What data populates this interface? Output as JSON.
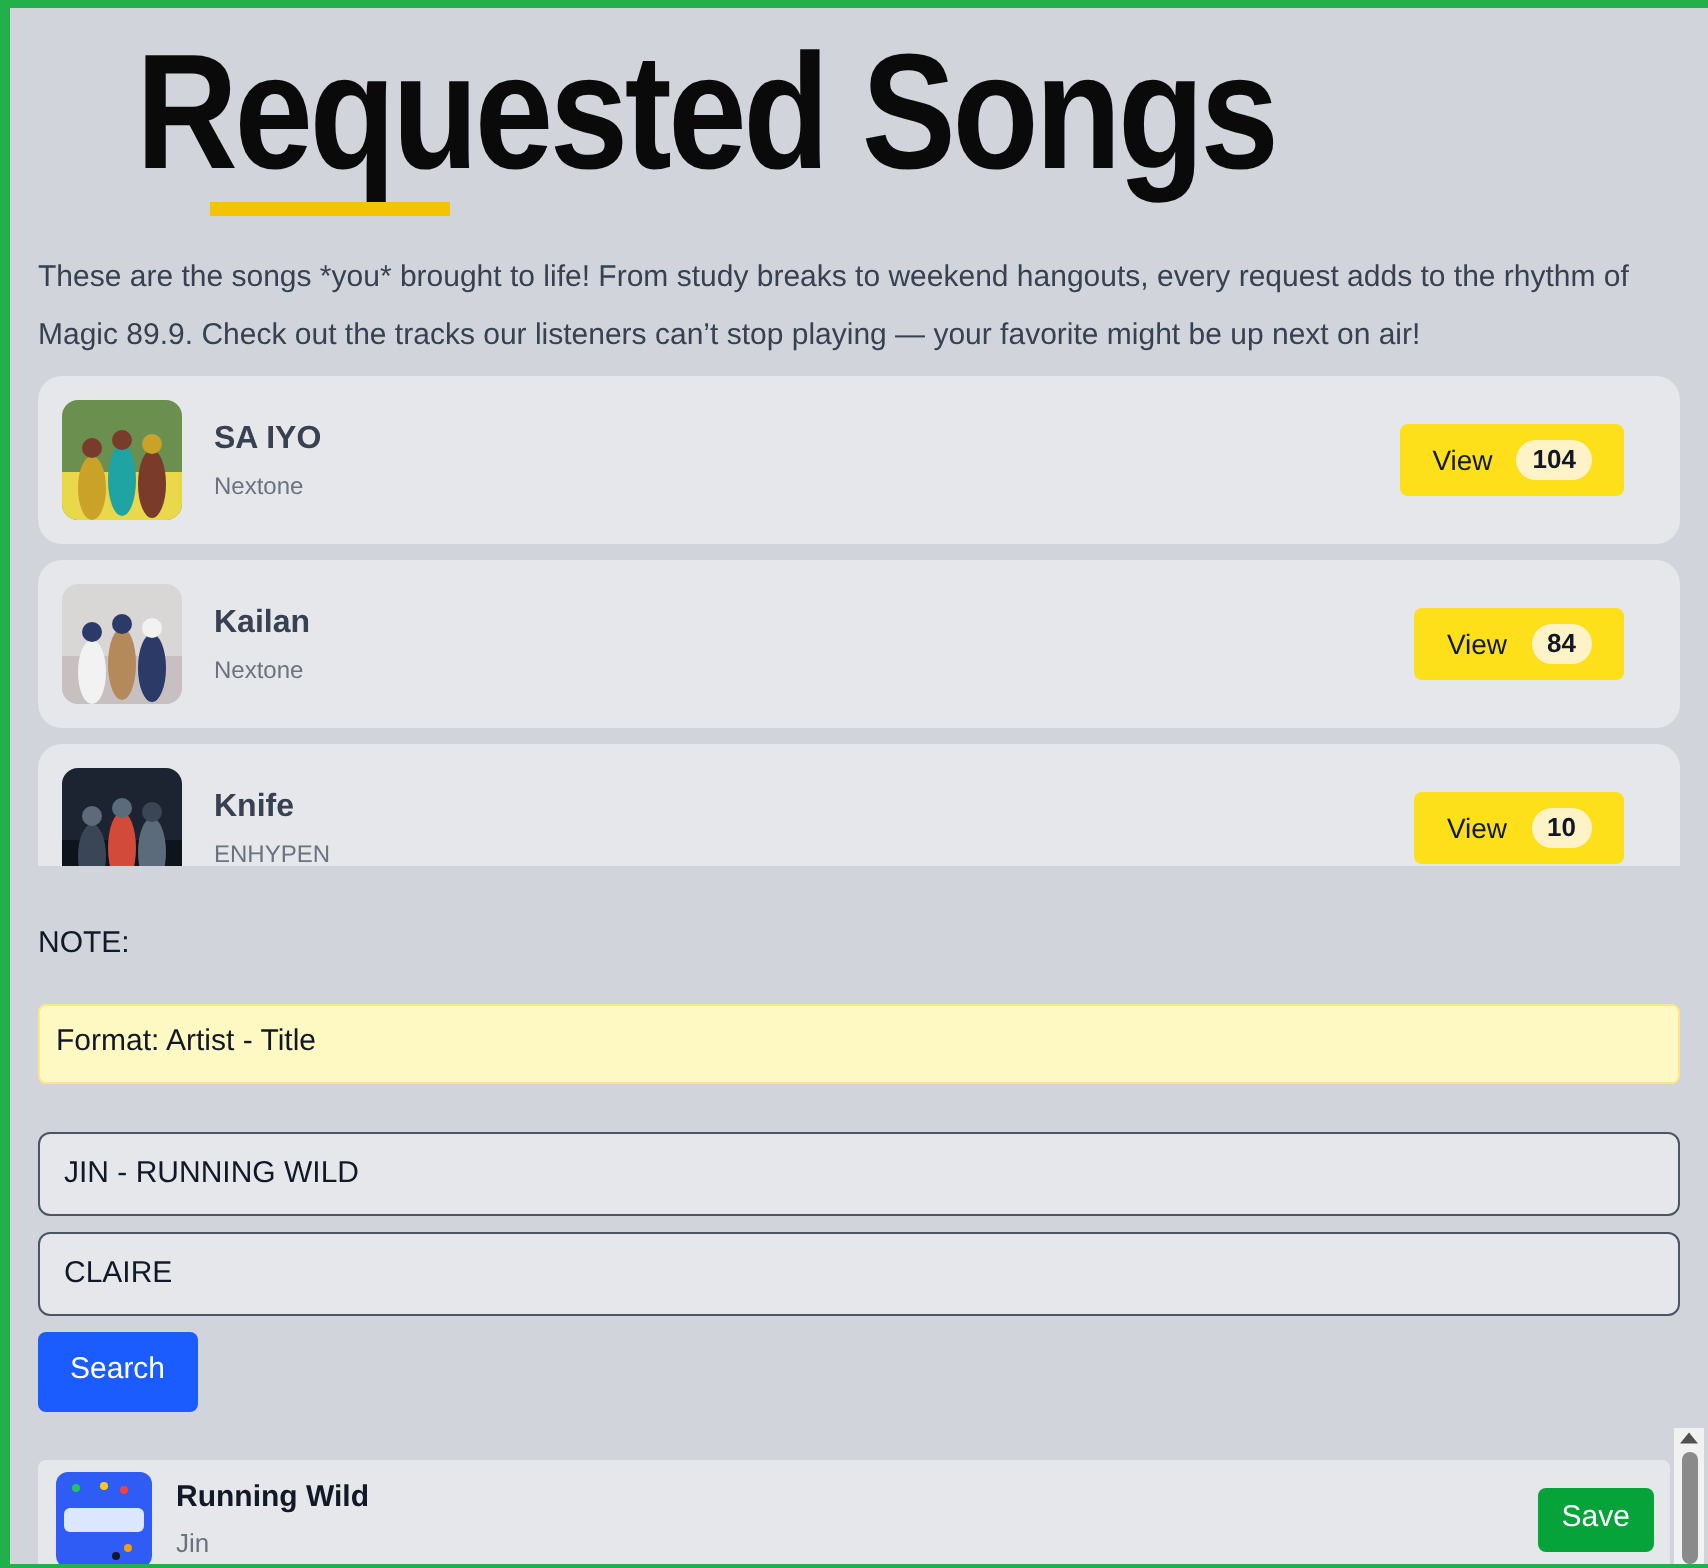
{
  "title": "Requested Songs",
  "intro": "These are the songs *you* brought to life! From study breaks to weekend hangouts, every request adds to the rhythm of Magic 89.9. Check out the tracks our listeners can’t stop playing — your favorite might be up next on air!",
  "requested_songs": [
    {
      "title": "SA IYO",
      "artist": "Nextone",
      "button": "View",
      "count": "104"
    },
    {
      "title": "Kailan",
      "artist": "Nextone",
      "button": "View",
      "count": "84"
    },
    {
      "title": "Knife",
      "artist": "ENHYPEN",
      "button": "View",
      "count": "10"
    }
  ],
  "note": {
    "label": "NOTE:",
    "format": "Format: Artist - Title"
  },
  "search_form": {
    "song_value": "JIN - RUNNING WILD",
    "name_value": "CLAIRE",
    "button": "Search"
  },
  "results": [
    {
      "title": "Running Wild",
      "artist": "Jin",
      "button": "Save"
    }
  ]
}
